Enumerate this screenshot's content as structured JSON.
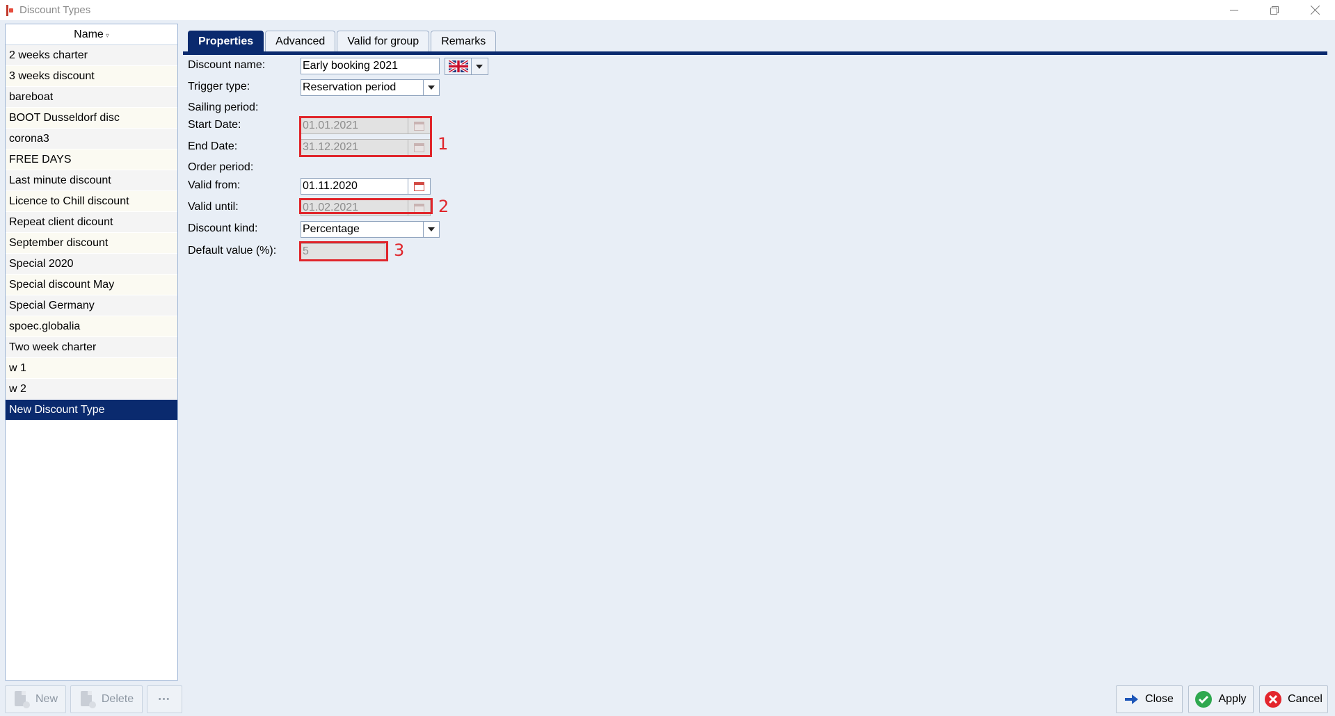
{
  "window": {
    "title": "Discount Types"
  },
  "list": {
    "header": "Name",
    "items": [
      "2 weeks charter",
      "3 weeks discount",
      "bareboat",
      "BOOT Dusseldorf disc",
      "corona3",
      "FREE DAYS",
      "Last minute discount",
      "Licence to Chill discount",
      "Repeat client dicount",
      "September discount",
      "Special 2020",
      "Special discount May",
      "Special Germany",
      "spoec.globalia",
      "Two week charter",
      "w 1",
      "w 2",
      "New Discount Type"
    ],
    "selected": "New Discount Type"
  },
  "list_buttons": {
    "new": "New",
    "delete": "Delete",
    "more": "•••"
  },
  "tabs": [
    "Properties",
    "Advanced",
    "Valid for group",
    "Remarks"
  ],
  "form": {
    "discount_name_label": "Discount name:",
    "discount_name_value": "Early booking 2021",
    "trigger_type_label": "Trigger type:",
    "trigger_type_value": "Reservation period",
    "sailing_period_label": "Sailing period:",
    "start_date_label": "Start Date:",
    "start_date_value": "01.01.2021",
    "end_date_label": "End Date:",
    "end_date_value": "31.12.2021",
    "order_period_label": "Order period:",
    "valid_from_label": "Valid from:",
    "valid_from_value": "01.11.2020",
    "valid_until_label": "Valid until:",
    "valid_until_value": "01.02.2021",
    "discount_kind_label": "Discount kind:",
    "discount_kind_value": "Percentage",
    "default_value_label": "Default value (%):",
    "default_value_value": "5"
  },
  "annotations": [
    "1",
    "2",
    "3"
  ],
  "actions": {
    "close": "Close",
    "apply": "Apply",
    "cancel": "Cancel"
  },
  "colors": {
    "accent": "#0a2a6e",
    "highlight": "#e0252b"
  }
}
